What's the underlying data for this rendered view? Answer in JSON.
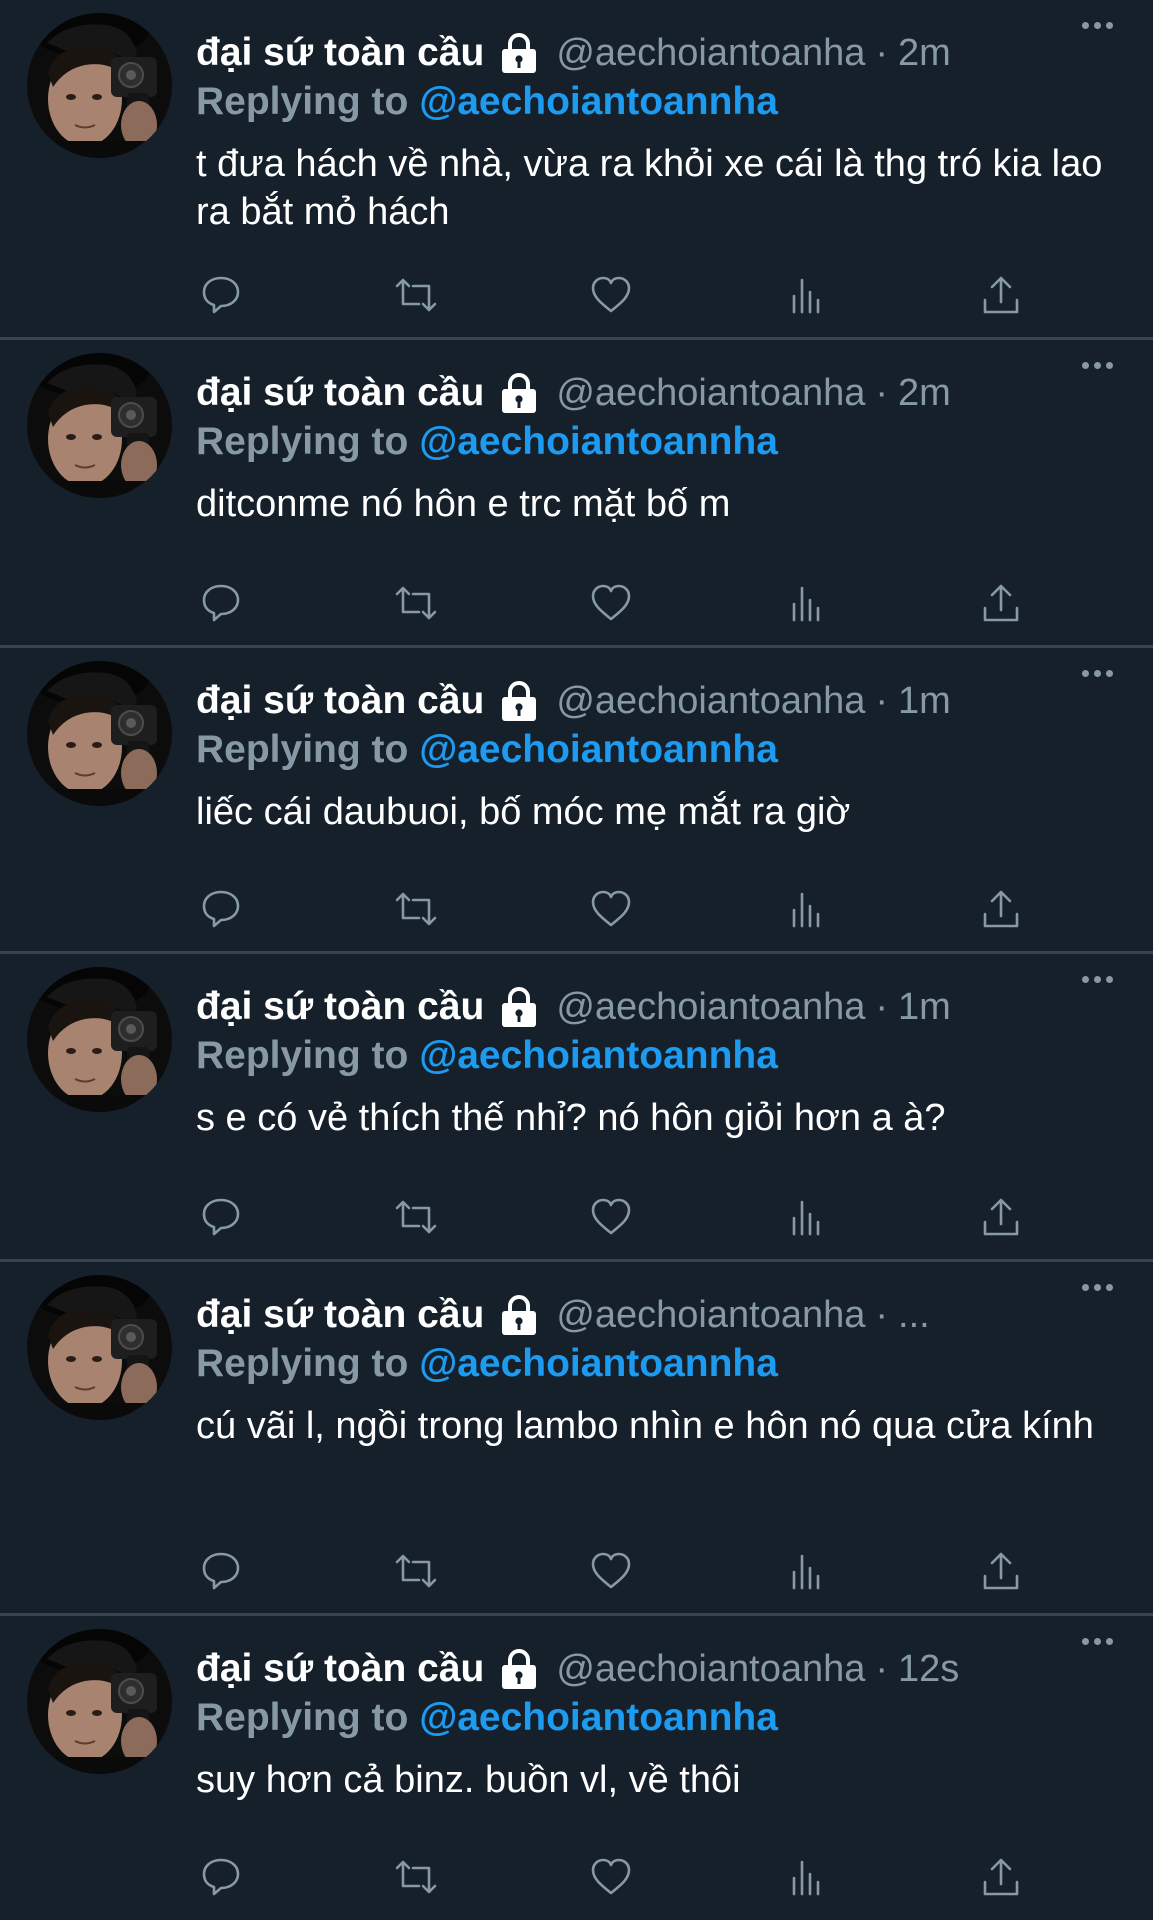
{
  "tweets": [
    {
      "display_name": "đại sứ toàn cầu",
      "handle": "@aechoiantoanha",
      "separator": "·",
      "time": "2m",
      "reply_prefix": "Replying to",
      "reply_handle": "@aechoiantoannha",
      "text": "t đưa hách về nhà, vừa ra khỏi xe cái là thg tró kia lao ra bắt mỏ hách"
    },
    {
      "display_name": "đại sứ toàn cầu",
      "handle": "@aechoiantoanha",
      "separator": "·",
      "time": "2m",
      "reply_prefix": "Replying to",
      "reply_handle": "@aechoiantoannha",
      "text": "ditconme nó hôn e trc mặt bố m"
    },
    {
      "display_name": "đại sứ toàn cầu",
      "handle": "@aechoiantoanha",
      "separator": "·",
      "time": "1m",
      "reply_prefix": "Replying to",
      "reply_handle": "@aechoiantoannha",
      "text": "liếc cái daubuoi, bố móc mẹ mắt ra giờ"
    },
    {
      "display_name": "đại sứ toàn cầu",
      "handle": "@aechoiantoanha",
      "separator": "·",
      "time": "1m",
      "reply_prefix": "Replying to",
      "reply_handle": "@aechoiantoannha",
      "text": "s e có vẻ thích thế nhỉ? nó hôn giỏi hơn a à?"
    },
    {
      "display_name": "đại sứ toàn cầu",
      "handle": "@aechoiantoanha",
      "separator": "·",
      "time": "...",
      "reply_prefix": "Replying to",
      "reply_handle": "@aechoiantoannha",
      "text": "cú vãi l, ngồi trong lambo nhìn e hôn nó qua cửa kính"
    },
    {
      "display_name": "đại sứ toàn cầu",
      "handle": "@aechoiantoanha",
      "separator": "·",
      "time": "12s",
      "reply_prefix": "Replying to",
      "reply_handle": "@aechoiantoannha",
      "text": "suy hơn cả binz. buồn vl, về thôi"
    }
  ],
  "icons": {
    "actions": [
      "reply-icon",
      "retweet-icon",
      "like-icon",
      "analytics-icon",
      "share-icon"
    ],
    "lock": "lock-icon",
    "more": "more-options-icon"
  },
  "colors": {
    "background": "#15202b",
    "divider": "#38444d",
    "secondary_text": "#8899a6",
    "link": "#1d9bf0",
    "primary_text": "#ffffff"
  }
}
